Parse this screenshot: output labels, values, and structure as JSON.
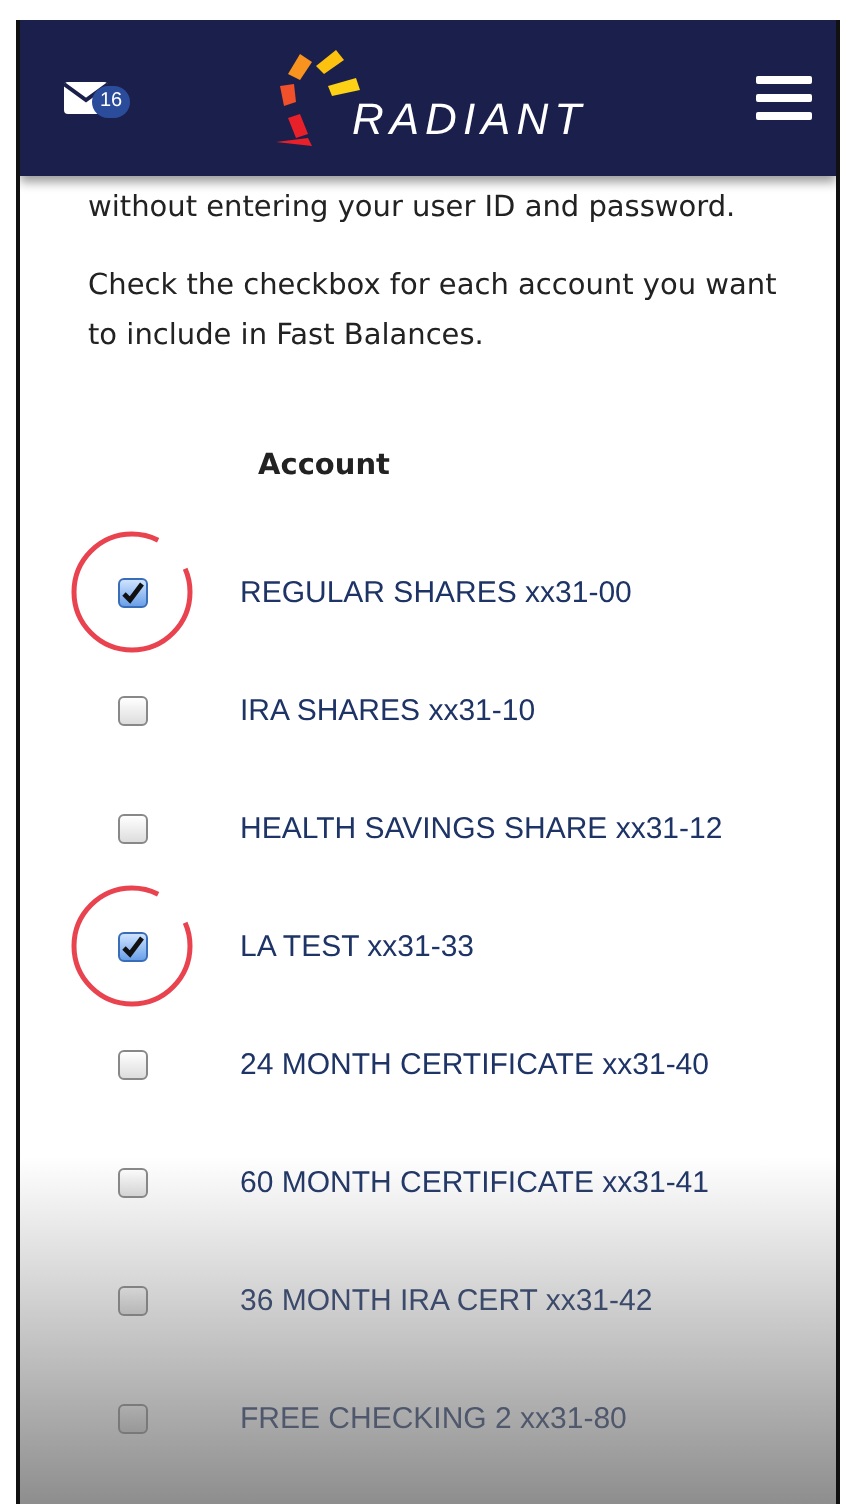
{
  "header": {
    "unread_count": "16",
    "logo_text": "RADIANT"
  },
  "intro": [
    "without entering your user ID and password.",
    "Check the checkbox for each account you want to include in Fast Balances."
  ],
  "table": {
    "column_header": "Account"
  },
  "accounts": [
    {
      "name": "REGULAR SHARES xx31-00",
      "checked": true,
      "circled": true
    },
    {
      "name": "IRA SHARES xx31-10",
      "checked": false,
      "circled": false
    },
    {
      "name": "HEALTH SAVINGS SHARE xx31-12",
      "checked": false,
      "circled": false
    },
    {
      "name": "LA TEST xx31-33",
      "checked": true,
      "circled": true
    },
    {
      "name": "24 MONTH CERTIFICATE xx31-40",
      "checked": false,
      "circled": false
    },
    {
      "name": "60 MONTH CERTIFICATE xx31-41",
      "checked": false,
      "circled": false
    },
    {
      "name": "36 MONTH IRA CERT xx31-42",
      "checked": false,
      "circled": false
    },
    {
      "name": "FREE CHECKING 2 xx31-80",
      "checked": false,
      "circled": false
    }
  ]
}
